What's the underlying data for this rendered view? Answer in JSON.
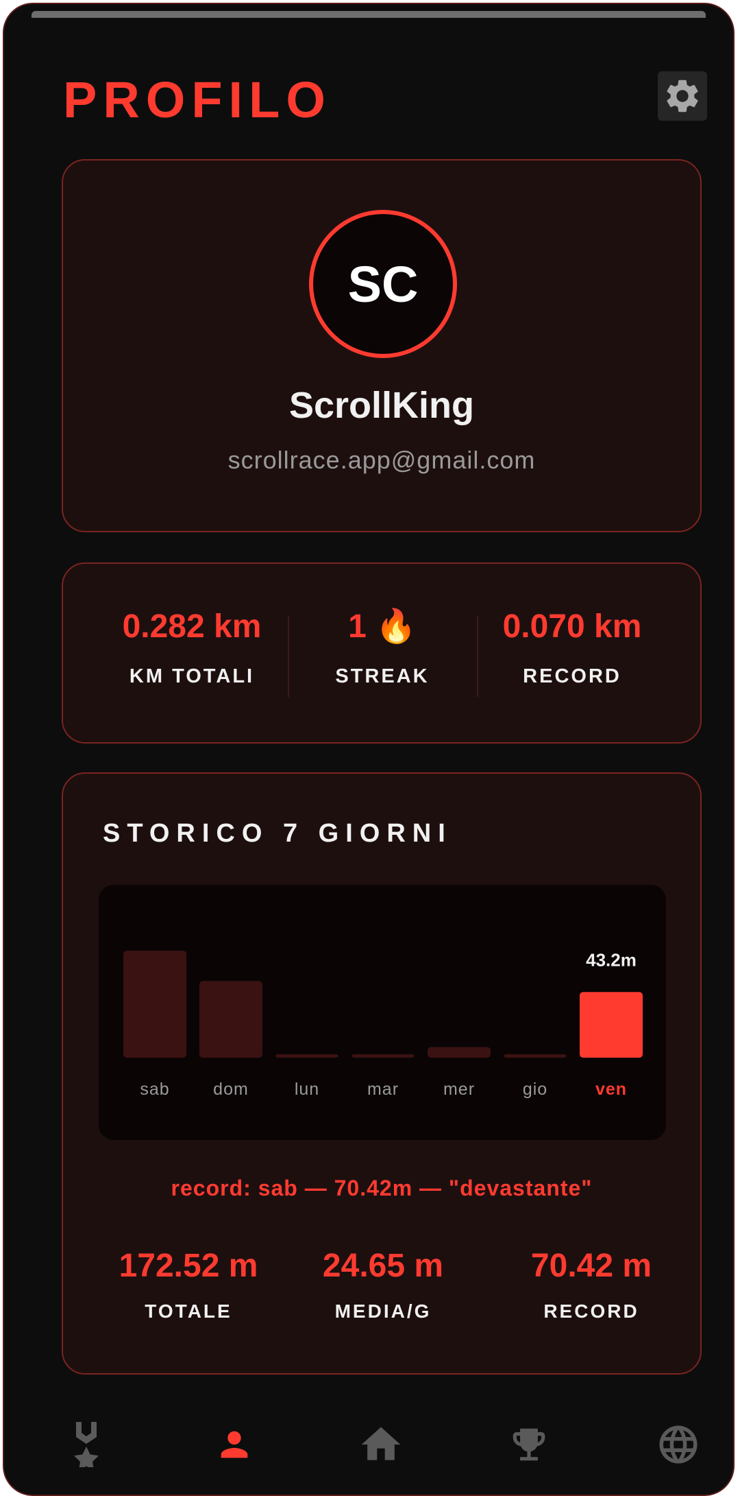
{
  "header": {
    "title": "PROFILO",
    "settings_icon": "gear-icon"
  },
  "profile": {
    "initials": "SC",
    "username": "ScrollKing",
    "email": "scrollrace.app@gmail.com"
  },
  "quick_stats": [
    {
      "value": "0.282 km",
      "label": "KM TOTALI"
    },
    {
      "value": "1 🔥",
      "label": "STREAK"
    },
    {
      "value": "0.070 km",
      "label": "RECORD"
    }
  ],
  "history": {
    "title": "STORICO 7 GIORNI",
    "record_line": "record: sab — 70.42m — \"devastante\"",
    "summary": [
      {
        "value": "172.52 m",
        "label": "TOTALE"
      },
      {
        "value": "24.65 m",
        "label": "MEDIA/G"
      },
      {
        "value": "70.42 m",
        "label": "RECORD"
      }
    ]
  },
  "chart_data": {
    "type": "bar",
    "categories": [
      "sab",
      "dom",
      "lun",
      "mar",
      "mer",
      "gio",
      "ven"
    ],
    "values": [
      70.42,
      50.5,
      2.2,
      2.2,
      7.0,
      2.2,
      43.2
    ],
    "highlight_index": 6,
    "highlight_label": "43.2m",
    "colors": {
      "bar": "#3a1212",
      "highlight": "#ff3b30",
      "label": "#9a9a9a",
      "highlight_label": "#ff3b30"
    }
  },
  "bottom_nav": [
    {
      "icon": "medal-icon",
      "active": false
    },
    {
      "icon": "person-icon",
      "active": true
    },
    {
      "icon": "home-icon",
      "active": false
    },
    {
      "icon": "trophy-icon",
      "active": false
    },
    {
      "icon": "globe-icon",
      "active": false
    }
  ],
  "colors": {
    "accent": "#ff3b30",
    "background": "#0d0d0d",
    "card": "#1e0f0f",
    "inactive_icon": "#5a5a5a"
  }
}
